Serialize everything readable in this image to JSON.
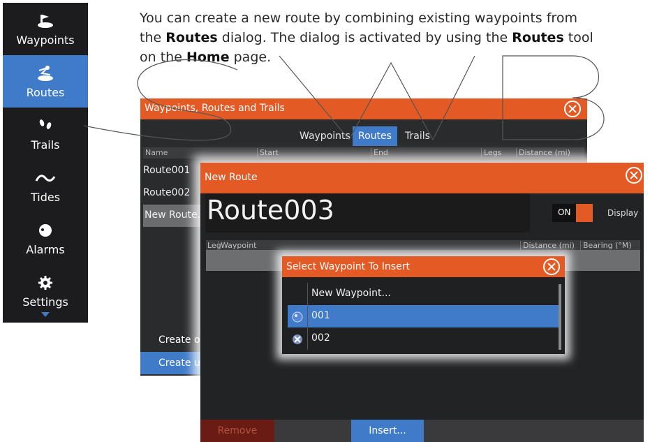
{
  "intro": {
    "line1": "You can create a new route by combining existing waypoints from",
    "line2_pre": "the ",
    "line2_bold": "Routes",
    "line2_mid": " dialog. The dialog is activated by using the ",
    "line2_bold2": "Routes",
    "line2_post": " tool",
    "line3_pre": "on the ",
    "line3_bold": "Home",
    "line3_post": " page."
  },
  "sidebar": {
    "items": [
      {
        "label": "Waypoints",
        "icon": "waypoints-icon"
      },
      {
        "label": "Routes",
        "icon": "routes-icon",
        "active": true
      },
      {
        "label": "Trails",
        "icon": "trails-icon"
      },
      {
        "label": "Tides",
        "icon": "tides-icon"
      },
      {
        "label": "Alarms",
        "icon": "alarms-icon"
      },
      {
        "label": "Settings",
        "icon": "gear-icon"
      }
    ]
  },
  "dialog_main": {
    "title": "Waypoints, Routes and Trails",
    "tabs": [
      "Waypoints",
      "Routes",
      "Trails"
    ],
    "active_tab": "Routes",
    "columns": [
      "Name",
      "Start",
      "End",
      "Legs",
      "Distance (mi)"
    ],
    "rows": [
      "Route001",
      "Route002",
      "New Route..."
    ],
    "buttons": [
      "Create o",
      "Create u"
    ]
  },
  "dialog_new_route": {
    "title": "New Route",
    "route_name": "Route003",
    "toggle_label": "ON",
    "display_label": "Display",
    "columns": [
      "Leg",
      "Waypoint",
      "Distance (mi)",
      "Bearing (°M)"
    ],
    "remove_label": "Remove",
    "insert_label": "Insert..."
  },
  "dialog_select": {
    "title": "Select Waypoint To Insert",
    "items": [
      "New Waypoint...",
      "001",
      "002"
    ],
    "selected": "001"
  },
  "colors": {
    "accent_orange": "#e35a25",
    "accent_blue": "#3f7bc9",
    "dark_bg": "#222325"
  }
}
